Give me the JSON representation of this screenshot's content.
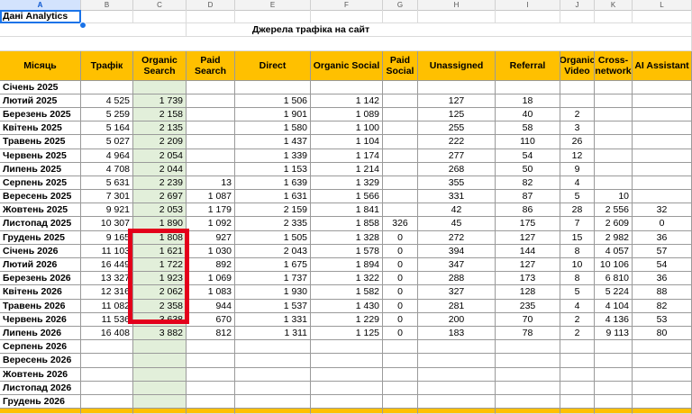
{
  "column_letters": [
    "A",
    "B",
    "C",
    "D",
    "E",
    "F",
    "G",
    "H",
    "I",
    "J",
    "K",
    "L"
  ],
  "selected_cell": "Дані Analytics",
  "title": "Джерела трафіка на сайт",
  "headers": [
    "Місяць",
    "Трафік",
    "Organic Search",
    "Paid Search",
    "Direct",
    "Organic Social",
    "Paid Social",
    "Unassigned",
    "Referral",
    "Organic Video",
    "Cross-network",
    "AI Assistant"
  ],
  "rows": [
    [
      "Січень 2025",
      "",
      "",
      "",
      "",
      "",
      "",
      "",
      "",
      "",
      "",
      ""
    ],
    [
      "Лютий 2025",
      "4 525",
      "1 739",
      "",
      "1 506",
      "1 142",
      "",
      "127",
      "18",
      "",
      "",
      ""
    ],
    [
      "Березень 2025",
      "5 259",
      "2 158",
      "",
      "1 901",
      "1 089",
      "",
      "125",
      "40",
      "2",
      "",
      ""
    ],
    [
      "Квітень 2025",
      "5 164",
      "2 135",
      "",
      "1 580",
      "1 100",
      "",
      "255",
      "58",
      "3",
      "",
      ""
    ],
    [
      "Травень 2025",
      "5 027",
      "2 209",
      "",
      "1 437",
      "1 104",
      "",
      "222",
      "110",
      "26",
      "",
      ""
    ],
    [
      "Червень 2025",
      "4 964",
      "2 054",
      "",
      "1 339",
      "1 174",
      "",
      "277",
      "54",
      "12",
      "",
      ""
    ],
    [
      "Липень 2025",
      "4 708",
      "2 044",
      "",
      "1 153",
      "1 214",
      "",
      "268",
      "50",
      "9",
      "",
      ""
    ],
    [
      "Серпень 2025",
      "5 631",
      "2 239",
      "13",
      "1 639",
      "1 329",
      "",
      "355",
      "82",
      "4",
      "",
      ""
    ],
    [
      "Вересень 2025",
      "7 301",
      "2 697",
      "1 087",
      "1 631",
      "1 566",
      "",
      "331",
      "87",
      "5",
      "10",
      ""
    ],
    [
      "Жовтень 2025",
      "9 921",
      "2 053",
      "1 179",
      "2 159",
      "1 841",
      "",
      "42",
      "86",
      "28",
      "2 556",
      "32"
    ],
    [
      "Листопад 2025",
      "10 307",
      "1 890",
      "1 092",
      "2 335",
      "1 858",
      "326",
      "45",
      "175",
      "7",
      "2 609",
      "0"
    ],
    [
      "Грудень 2025",
      "9 165",
      "1 808",
      "927",
      "1 505",
      "1 328",
      "0",
      "272",
      "127",
      "15",
      "2 982",
      "36"
    ],
    [
      "Січень 2026",
      "11 103",
      "1 621",
      "1 030",
      "2 043",
      "1 578",
      "0",
      "394",
      "144",
      "8",
      "4 057",
      "57"
    ],
    [
      "Лютий 2026",
      "16 449",
      "1 722",
      "892",
      "1 675",
      "1 894",
      "0",
      "347",
      "127",
      "10",
      "10 106",
      "54"
    ],
    [
      "Березень 2026",
      "13 327",
      "1 923",
      "1 069",
      "1 737",
      "1 322",
      "0",
      "288",
      "173",
      "8",
      "6 810",
      "36"
    ],
    [
      "Квітень 2026",
      "12 316",
      "2 062",
      "1 083",
      "1 930",
      "1 582",
      "0",
      "327",
      "128",
      "5",
      "5 224",
      "88"
    ],
    [
      "Травень 2026",
      "11 082",
      "2 358",
      "944",
      "1 537",
      "1 430",
      "0",
      "281",
      "235",
      "4",
      "4 104",
      "82"
    ],
    [
      "Червень 2026",
      "11 536",
      "3 638",
      "670",
      "1 331",
      "1 229",
      "0",
      "200",
      "70",
      "2",
      "4 136",
      "53"
    ],
    [
      "Липень 2026",
      "16 408",
      "3 882",
      "812",
      "1 311",
      "1 125",
      "0",
      "183",
      "78",
      "2",
      "9 113",
      "80"
    ],
    [
      "Серпень 2026",
      "",
      "",
      "",
      "",
      "",
      "",
      "",
      "",
      "",
      "",
      ""
    ],
    [
      "Вересень 2026",
      "",
      "",
      "",
      "",
      "",
      "",
      "",
      "",
      "",
      "",
      ""
    ],
    [
      "Жовтень 2026",
      "",
      "",
      "",
      "",
      "",
      "",
      "",
      "",
      "",
      "",
      ""
    ],
    [
      "Листопад 2026",
      "",
      "",
      "",
      "",
      "",
      "",
      "",
      "",
      "",
      "",
      ""
    ],
    [
      "Грудень 2026",
      "",
      "",
      "",
      "",
      "",
      "",
      "",
      "",
      "",
      "",
      ""
    ]
  ]
}
